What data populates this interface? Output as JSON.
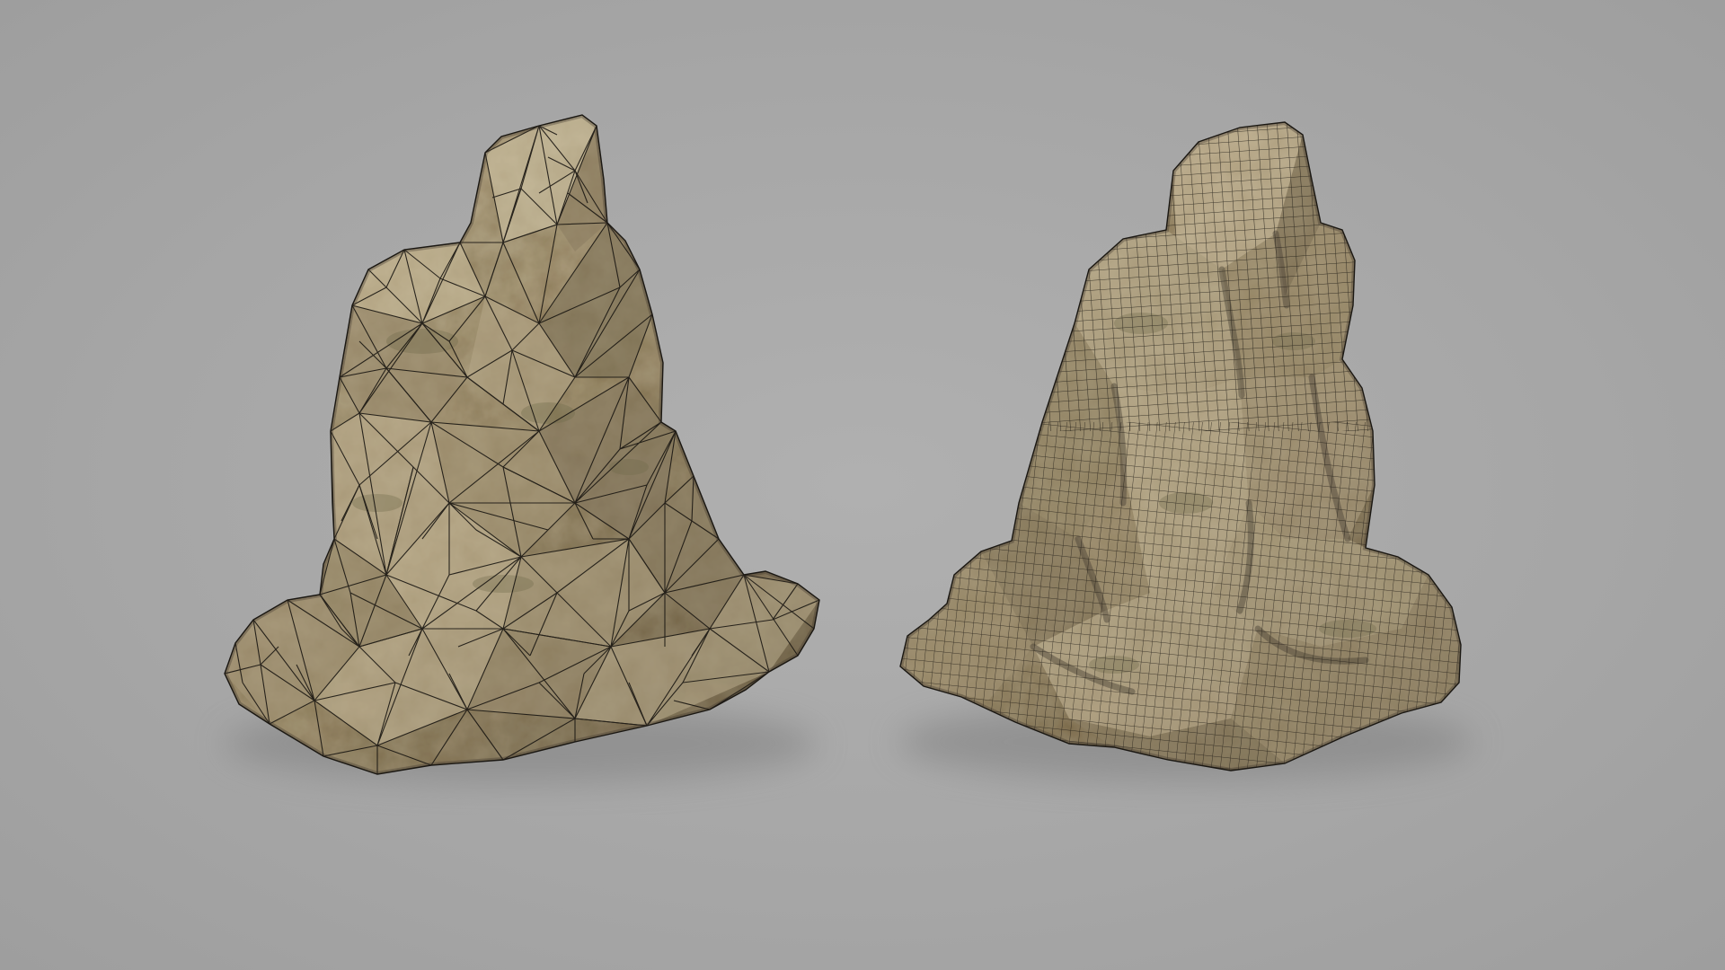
{
  "scene": {
    "background_color": "#a9a9a9",
    "rock_base_color": "#a39579",
    "rock_dark_color": "#6e6350",
    "rock_light_color": "#c8bc9f",
    "moss_color": "#7b7655",
    "wire_color": "#1a1712",
    "models": [
      {
        "name": "low-poly-rock",
        "wireframe": "triangulated"
      },
      {
        "name": "high-poly-rock",
        "wireframe": "quad-grid"
      }
    ]
  }
}
